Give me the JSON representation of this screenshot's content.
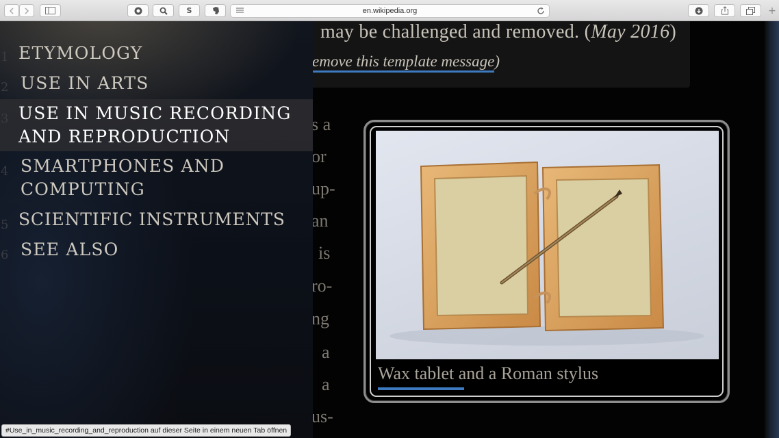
{
  "browser": {
    "url": "en.wikipedia.org",
    "icons": {
      "back": "chevron-left-icon",
      "forward": "chevron-right-icon",
      "sidebar": "sidebar-icon",
      "reader": "reader-lines-icon",
      "reload": "reload-icon",
      "download": "download-icon",
      "share": "share-icon",
      "tabs": "tabs-icon",
      "new_tab": "plus-icon"
    },
    "extension_s_label": "S",
    "new_tab_label": "+"
  },
  "notice": {
    "line1_text": "may be challenged and removed. (",
    "line1_date": "May 2016",
    "line1_close": ")",
    "line2_link": "emove this template message",
    "line2_close": ")"
  },
  "background_fragments": [
    "s a",
    "or",
    "up-",
    "an",
    "is",
    "ro-",
    "ng",
    "a",
    "a",
    "us-"
  ],
  "figure": {
    "caption": "Wax tablet and a Roman stylus"
  },
  "toc": {
    "items": [
      {
        "num": "1",
        "label": "Etymology",
        "active": false
      },
      {
        "num": "2",
        "label": "Use in arts",
        "active": false
      },
      {
        "num": "3",
        "label": "Use in music recording and reproduction",
        "active": true
      },
      {
        "num": "4",
        "label": "Smartphones and computing",
        "active": false
      },
      {
        "num": "5",
        "label": "Scientific instruments",
        "active": false
      },
      {
        "num": "6",
        "label": "See also",
        "active": false
      }
    ]
  },
  "status_bar": {
    "text": "#Use_in_music_recording_and_reproduction auf dieser Seite in einem neuen Tab öffnen"
  },
  "colors": {
    "link_underline": "#3d7ac0",
    "page_background": "#030303",
    "toc_active_text": "#ffffff"
  }
}
